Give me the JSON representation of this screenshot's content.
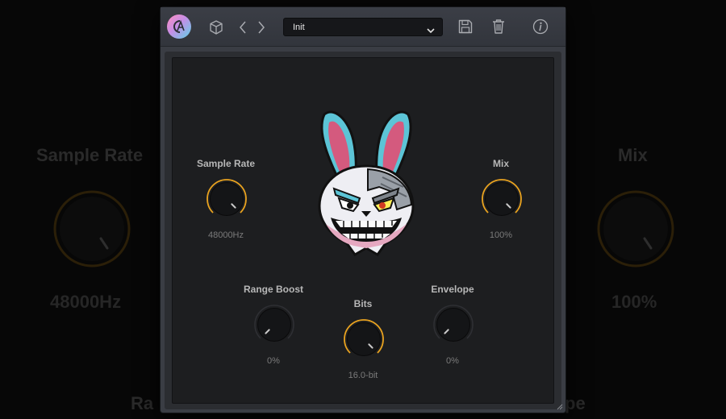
{
  "background": {
    "sample_rate_label": "Sample Rate",
    "sample_rate_value": "48000Hz",
    "mix_label": "Mix",
    "mix_value": "100%",
    "bottom_left_fragment": "Ra",
    "bottom_right_fragment": "pe"
  },
  "toolbar": {
    "logo_icon": "ca-logo-icon",
    "preset_name": "Init",
    "icons": [
      "cube-icon",
      "chevron-left-icon",
      "chevron-right-icon",
      "chevron-down-icon",
      "save-icon",
      "trash-icon",
      "info-icon"
    ]
  },
  "knobs": {
    "sample_rate": {
      "label": "Sample Rate",
      "value": "48000Hz",
      "level": 1.0,
      "active": true
    },
    "mix": {
      "label": "Mix",
      "value": "100%",
      "level": 1.0,
      "active": true
    },
    "range_boost": {
      "label": "Range Boost",
      "value": "0%",
      "level": 0.0,
      "active": false
    },
    "bits": {
      "label": "Bits",
      "value": "16.0-bit",
      "level": 1.0,
      "active": true
    },
    "envelope": {
      "label": "Envelope",
      "value": "0%",
      "level": 0.0,
      "active": false
    }
  },
  "colors": {
    "accent": "#e8a21f",
    "window": "#3a3d44",
    "panel": "#1d1e20"
  },
  "illustration": "cyborg-rabbit-mascot"
}
